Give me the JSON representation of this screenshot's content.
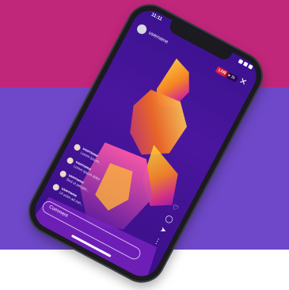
{
  "colors": {
    "band_top": "#c0267a",
    "band_middle": "#6e48c8",
    "live_badge": "#e02040"
  },
  "status_bar": {
    "time": "11:11"
  },
  "live_header": {
    "username": "username",
    "live_label": "LIVE",
    "viewer_label": "● 3k",
    "close_icon": "close-icon"
  },
  "comments": [
    {
      "name": "username",
      "text": "Lorem ipsum..."
    },
    {
      "name": "username",
      "text": "Lorem ipsum dolor"
    },
    {
      "name": "username",
      "text": "Sed ut perspic..."
    },
    {
      "name": "username",
      "text": "Ut enim ad min..."
    }
  ],
  "actions": [
    {
      "icon": "heart-icon",
      "glyph": "♡"
    },
    {
      "icon": "chat-icon",
      "glyph": "◯"
    },
    {
      "icon": "send-icon",
      "glyph": "➤"
    },
    {
      "icon": "more-icon",
      "glyph": "⋮"
    }
  ],
  "comment_bar": {
    "placeholder": "Comment"
  }
}
